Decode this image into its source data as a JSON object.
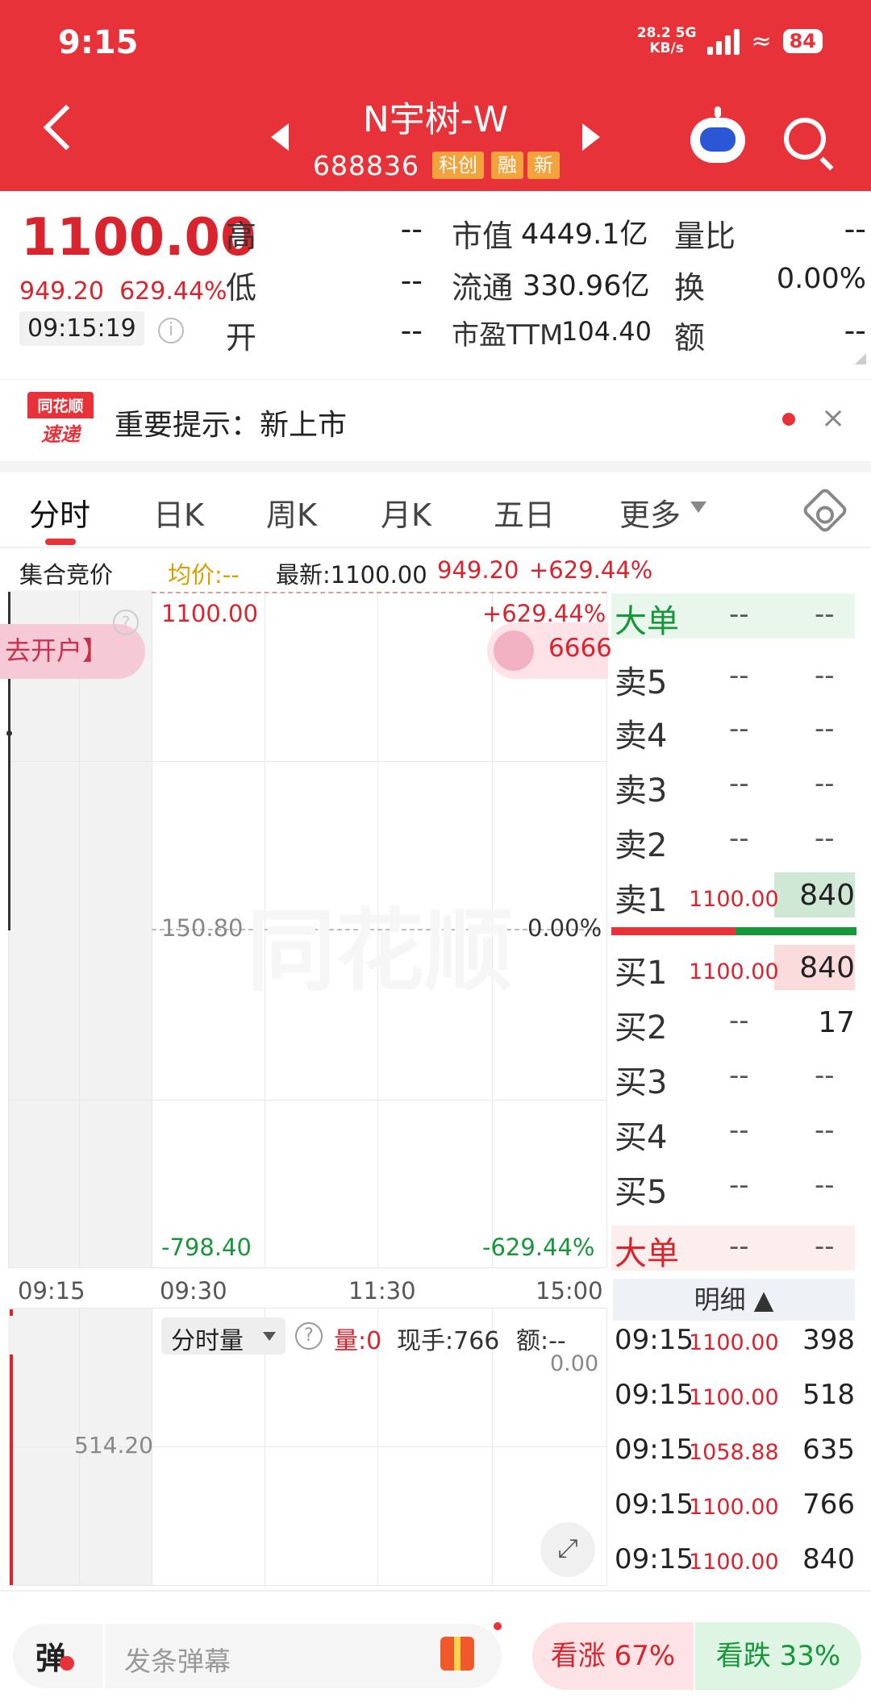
{
  "status": {
    "time": "9:15",
    "speed_top": "28.2",
    "speed_bottom": "KB/s",
    "net": "5G",
    "battery": "84"
  },
  "header": {
    "stock_name": "N宇树-W",
    "stock_code": "688836",
    "tags": [
      "科创",
      "融",
      "新"
    ],
    "back_icon": "back-arrow",
    "robot_icon": "robot",
    "search_icon": "search"
  },
  "quote": {
    "price": "1100.00",
    "change": "949.20",
    "change_pct": "629.44%",
    "time": "09:15:19",
    "fields": [
      {
        "label": "高",
        "value": "--"
      },
      {
        "label": "低",
        "value": "--"
      },
      {
        "label": "开",
        "value": "--"
      },
      {
        "label": "市值",
        "value": "4449.1亿"
      },
      {
        "label": "流通",
        "value": "330.96亿"
      },
      {
        "label": "市盈TTM",
        "value": "104.40"
      },
      {
        "label": "量比",
        "value": "--"
      },
      {
        "label": "换",
        "value": "0.00%"
      },
      {
        "label": "额",
        "value": "--"
      }
    ]
  },
  "notice": {
    "logo_top": "同花顺",
    "logo_bottom": "速递",
    "text": "重要提示：新上市",
    "close": "×"
  },
  "tabs": [
    "分时",
    "日K",
    "周K",
    "月K",
    "五日",
    "更多"
  ],
  "infoline": {
    "auction": "集合竞价",
    "avg": "均价:--",
    "latest": "最新:1100.00",
    "change": "949.20",
    "pct": "+629.44%"
  },
  "chart": {
    "top_price": "1100.00",
    "top_pct": "+629.44%",
    "mid_price": "150.80",
    "mid_pct": "0.00%",
    "bottom_price": "-798.40",
    "bottom_pct": "-629.44%",
    "x_labels": [
      "09:15",
      "09:30",
      "11:30",
      "15:00"
    ],
    "open_account": "去开户】",
    "float_num": "6666",
    "vol_selector": "分时量",
    "vol_qty": "量:0",
    "vol_hand": "现手:766",
    "vol_amt": "额:--",
    "vol_right": "0.00",
    "vol_left": "514.20",
    "watermark": "同花顺",
    "colors": {
      "up": "#d9232d",
      "down": "#17963a"
    }
  },
  "orderbook": {
    "big_top": {
      "label": "大单",
      "a": "--",
      "b": "--"
    },
    "sells": [
      {
        "label": "卖5",
        "price": "--",
        "vol": "--"
      },
      {
        "label": "卖4",
        "price": "--",
        "vol": "--"
      },
      {
        "label": "卖3",
        "price": "--",
        "vol": "--"
      },
      {
        "label": "卖2",
        "price": "--",
        "vol": "--"
      },
      {
        "label": "卖1",
        "price": "1100.00",
        "vol": "840"
      }
    ],
    "buys": [
      {
        "label": "买1",
        "price": "1100.00",
        "vol": "840"
      },
      {
        "label": "买2",
        "price": "--",
        "vol": "17"
      },
      {
        "label": "买3",
        "price": "--",
        "vol": "--"
      },
      {
        "label": "买4",
        "price": "--",
        "vol": "--"
      },
      {
        "label": "买5",
        "price": "--",
        "vol": "--"
      }
    ],
    "big_bottom": {
      "label": "大单",
      "a": "--",
      "b": "--"
    },
    "mingxi_label": "明细 ▲",
    "mingxi": [
      {
        "time": "09:15",
        "price": "1100.00",
        "vol": "398"
      },
      {
        "time": "09:15",
        "price": "1100.00",
        "vol": "518"
      },
      {
        "time": "09:15",
        "price": "1058.88",
        "vol": "635"
      },
      {
        "time": "09:15",
        "price": "1100.00",
        "vol": "766"
      },
      {
        "time": "09:15",
        "price": "1100.00",
        "vol": "840"
      }
    ]
  },
  "bottom": {
    "danmu_icon": "弹",
    "placeholder": "发条弹幕",
    "bull": "看涨 67%",
    "bear": "看跌 33%"
  }
}
